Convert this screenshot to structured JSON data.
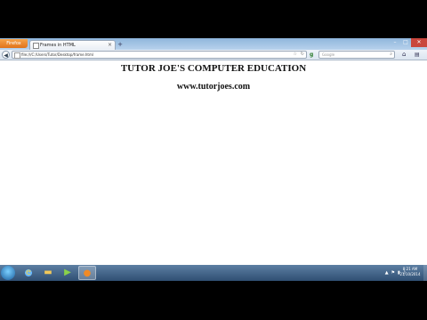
{
  "browser": {
    "app_button_label": "Firefox",
    "tab_title": "Frames in HTML",
    "tab_close": "×",
    "new_tab": "+",
    "url": "file:///C:/Users/Tutor/Desktop/frame.html",
    "search_placeholder": "Google",
    "search_engine_glyph": "g",
    "window_controls": {
      "minimize": "–",
      "maximize": "□",
      "close": "✕"
    }
  },
  "page": {
    "heading": "TUTOR JOE'S COMPUTER EDUCATION",
    "link": "www.tutorjoes.com"
  },
  "taskbar": {
    "clock_time": "8:21 AM",
    "clock_date": "21/10/2014"
  },
  "colors": {
    "titlebar": "#a6c4e4",
    "firefox_orange": "#e47d22",
    "taskbar": "#3d5e85"
  }
}
